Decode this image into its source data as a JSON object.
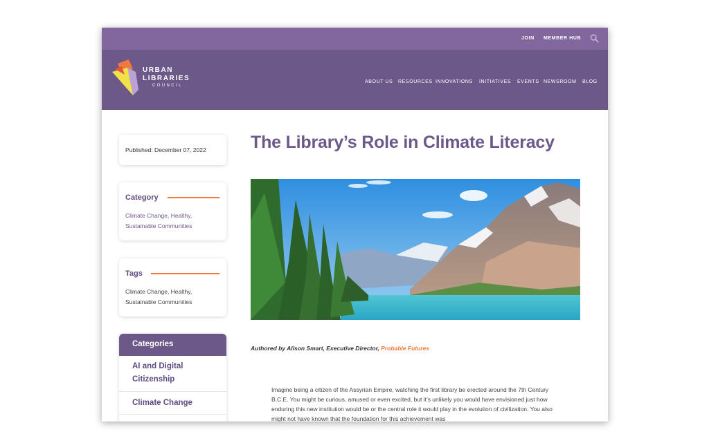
{
  "utility_nav": {
    "join": "JOIN",
    "member_hub": "MEMBER HUB",
    "search_icon": "search-icon"
  },
  "logo": {
    "line1": "URBAN",
    "line2": "LIBRARIES",
    "line3": "COUNCIL"
  },
  "main_nav": [
    "ABOUT US",
    "RESOURCES",
    "INNOVATIONS",
    "INITIATIVES",
    "EVENTS",
    "NEWSROOM",
    "BLOG"
  ],
  "sidebar": {
    "published": "Published: December 07, 2022",
    "category": {
      "heading": "Category",
      "items": [
        "Climate Change",
        "Healthy",
        "Sustainable Communities"
      ]
    },
    "tags": {
      "heading": "Tags",
      "text_line1": "Climate Change, Healthy,",
      "text_line2": "Sustainable Communities"
    },
    "categories_widget": {
      "heading": "Categories",
      "items": [
        "AI and Digital Citizenship",
        "Climate Change"
      ]
    }
  },
  "article": {
    "title": "The Library’s Role in Climate Literacy",
    "byline_prefix": "Authored by Alison Smart, Executive Director, ",
    "byline_link": "Probable Futures",
    "body": "Imagine being a citizen of the Assyrian Empire, watching the first library be erected around the 7th Century B.C.E. You might be curious, amused or even excited, but it’s unlikely you would have envisioned just how enduring this new institution would be or the central role it would play in the evolution of civilization. You also might not have known that the foundation for this achievement was"
  },
  "colors": {
    "util_bar": "#82679e",
    "header": "#6c5889",
    "accent_orange": "#f07a3c",
    "heading_purple": "#5f4b82"
  }
}
